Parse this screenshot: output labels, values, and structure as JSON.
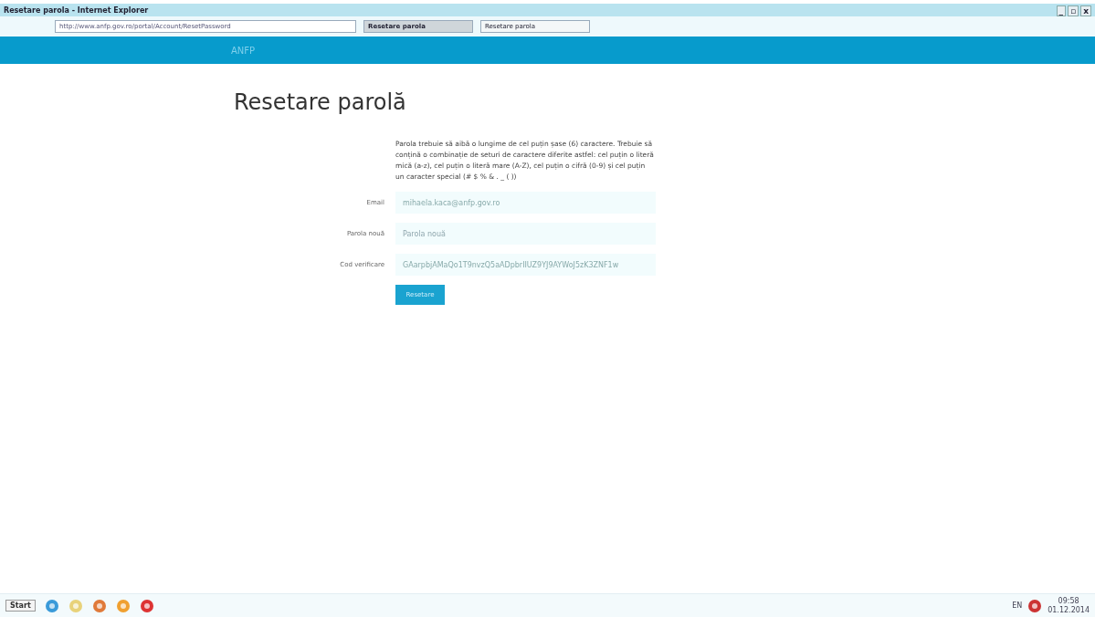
{
  "window": {
    "title": "Resetare parola - Internet Explorer",
    "controls": [
      "_",
      "▫",
      "x"
    ]
  },
  "browser": {
    "url": "http://www.anfp.gov.ro/portal/Account/ResetPassword",
    "tabs": [
      {
        "label": "Resetare parola",
        "selected": true
      },
      {
        "label": "Resetare parola",
        "selected": false
      }
    ]
  },
  "navbar": {
    "brand": "ANFP"
  },
  "page": {
    "heading": "Resetare parolă",
    "rules": "Parola trebuie să aibă o lungime de cel puțin șase (6) caractere. Trebuie să conțină o combinație de seturi de caractere diferite astfel: cel puțin o literă mică (a-z), cel puțin o literă mare (A-Z), cel puțin o cifră (0-9) și cel puțin un caracter special (# $ % & . _ ( ))",
    "fields": [
      {
        "label": "Email",
        "value": "mihaela.kaca@anfp.gov.ro"
      },
      {
        "label": "Parola nouă",
        "placeholder": "Parola nouă"
      },
      {
        "label": "Cod verificare",
        "value": "GAarpbjAMaQo1T9nvzQ5aADpbrIIUZ9YJ9AYWoJ5zK3ZNF1w"
      }
    ],
    "submit": "Resetare"
  },
  "taskbar": {
    "start": "Start",
    "language": "EN",
    "time": "09:58",
    "date": "01.12.2014"
  }
}
